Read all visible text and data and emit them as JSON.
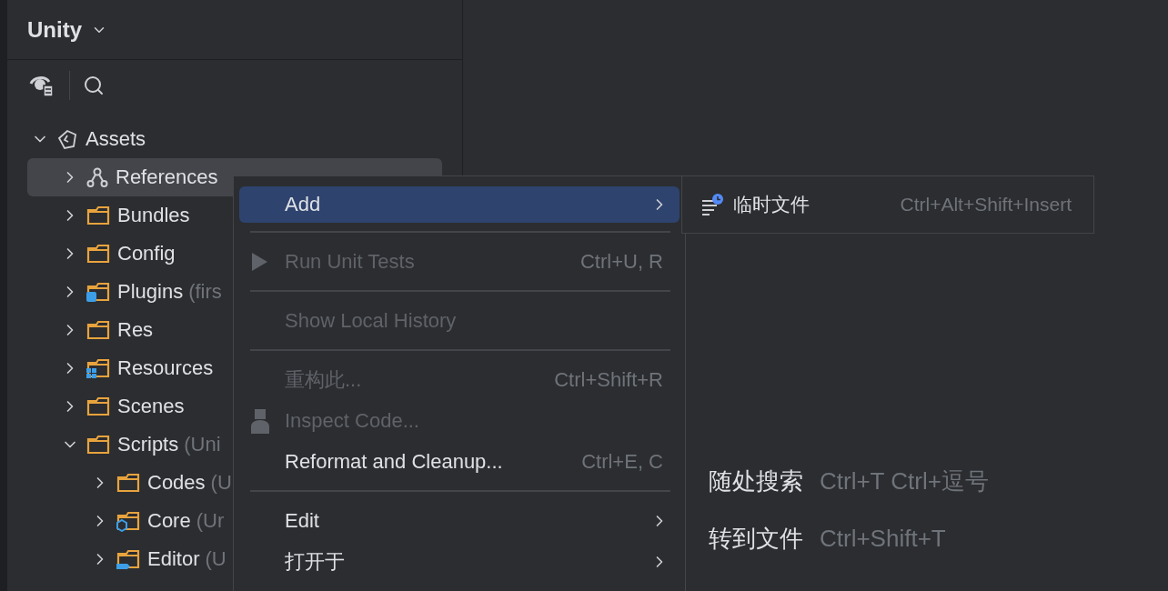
{
  "project": {
    "title": "Unity"
  },
  "tree": [
    {
      "label": "Assets",
      "kind": "assets",
      "expanded": true,
      "selected": false,
      "children": [
        {
          "label": "References",
          "kind": "references",
          "expanded": false,
          "selected": true
        },
        {
          "label": "Bundles",
          "kind": "folder",
          "expanded": false,
          "selected": false
        },
        {
          "label": "Config",
          "kind": "folder",
          "expanded": false,
          "selected": false
        },
        {
          "label": "Plugins",
          "note": "(firs",
          "kind": "plugin",
          "expanded": false,
          "selected": false
        },
        {
          "label": "Res",
          "kind": "folder",
          "expanded": false,
          "selected": false
        },
        {
          "label": "Resources",
          "kind": "resources",
          "expanded": false,
          "selected": false
        },
        {
          "label": "Scenes",
          "kind": "folder",
          "expanded": false,
          "selected": false
        },
        {
          "label": "Scripts",
          "note": "(Uni",
          "kind": "folder",
          "expanded": true,
          "selected": false,
          "children": [
            {
              "label": "Codes",
              "note": "(U",
              "kind": "folder",
              "expanded": false,
              "selected": false
            },
            {
              "label": "Core",
              "note": "(Ur",
              "kind": "package",
              "expanded": false,
              "selected": false
            },
            {
              "label": "Editor",
              "note": "(U",
              "kind": "editor",
              "expanded": false,
              "selected": false
            }
          ]
        }
      ]
    }
  ],
  "context_menu": [
    {
      "kind": "item",
      "label": "Add",
      "submenu": true,
      "selected": true,
      "disabled": false
    },
    {
      "kind": "separator"
    },
    {
      "kind": "run",
      "label": "Run Unit Tests",
      "shortcut": "Ctrl+U, R",
      "submenu": false,
      "selected": false,
      "disabled": true
    },
    {
      "kind": "separator"
    },
    {
      "kind": "item",
      "label": "Show Local History",
      "submenu": false,
      "selected": false,
      "disabled": true
    },
    {
      "kind": "separator"
    },
    {
      "kind": "item",
      "label": "重构此...",
      "shortcut": "Ctrl+Shift+R",
      "submenu": false,
      "selected": false,
      "disabled": true
    },
    {
      "kind": "inspect",
      "label": "Inspect Code...",
      "submenu": false,
      "selected": false,
      "disabled": true
    },
    {
      "kind": "item",
      "label": "Reformat and Cleanup...",
      "shortcut": "Ctrl+E, C",
      "submenu": false,
      "selected": false,
      "disabled": false
    },
    {
      "kind": "separator"
    },
    {
      "kind": "item",
      "label": "Edit",
      "submenu": true,
      "selected": false,
      "disabled": false
    },
    {
      "kind": "item",
      "label": "打开于",
      "submenu": true,
      "selected": false,
      "disabled": false
    }
  ],
  "submenu": [
    {
      "label": "临时文件",
      "shortcut": "Ctrl+Alt+Shift+Insert"
    }
  ],
  "editor_hints": [
    {
      "action": "随处搜索",
      "shortcut": "Ctrl+T Ctrl+逗号"
    },
    {
      "action": "转到文件",
      "shortcut": "Ctrl+Shift+T"
    }
  ]
}
